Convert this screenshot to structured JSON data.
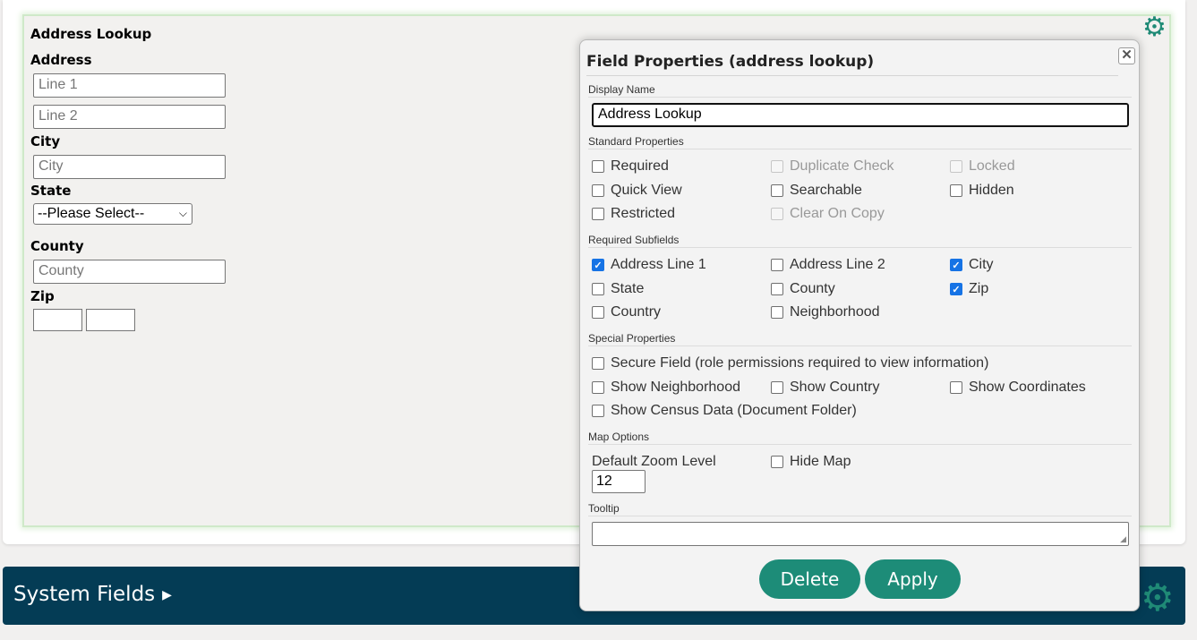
{
  "form": {
    "title": "Address Lookup",
    "address_label": "Address",
    "line1_placeholder": "Line 1",
    "line2_placeholder": "Line 2",
    "city_label": "City",
    "city_placeholder": "City",
    "state_label": "State",
    "state_selected": "--Please Select--",
    "county_label": "County",
    "county_placeholder": "County",
    "zip_label": "Zip",
    "zip_value_1": "",
    "zip_value_2": ""
  },
  "system_fields": {
    "title": "System Fields"
  },
  "dialog": {
    "title": "Field Properties (address lookup)",
    "close_glyph": "✕",
    "display_name": {
      "label": "Display Name",
      "value": "Address Lookup"
    },
    "standard_properties": {
      "label": "Standard Properties",
      "required": "Required",
      "duplicate_check": "Duplicate Check",
      "locked": "Locked",
      "quick_view": "Quick View",
      "searchable": "Searchable",
      "hidden": "Hidden",
      "restricted": "Restricted",
      "clear_on_copy": "Clear On Copy"
    },
    "required_subfields": {
      "label": "Required Subfields",
      "address_line_1": "Address Line 1",
      "address_line_2": "Address Line 2",
      "city": "City",
      "state": "State",
      "county": "County",
      "zip": "Zip",
      "country": "Country",
      "neighborhood": "Neighborhood"
    },
    "special_properties": {
      "label": "Special Properties",
      "secure_field": "Secure Field (role permissions required to view information)",
      "show_neighborhood": "Show Neighborhood",
      "show_country": "Show Country",
      "show_coordinates": "Show Coordinates",
      "show_census_data": "Show Census Data (Document Folder)"
    },
    "map_options": {
      "label": "Map Options",
      "default_zoom_label": "Default Zoom Level",
      "default_zoom_value": "12",
      "hide_map": "Hide Map"
    },
    "tooltip": {
      "label": "Tooltip",
      "value": ""
    },
    "delete_label": "Delete",
    "apply_label": "Apply"
  },
  "icons": {
    "gear": "gear-icon",
    "close": "close-icon",
    "caret": "caret-right-icon"
  },
  "colors": {
    "accent": "#1d8c78",
    "banner": "#043c55",
    "checkbox_checked": "#1673e5",
    "form_border": "#cfe9c9"
  }
}
